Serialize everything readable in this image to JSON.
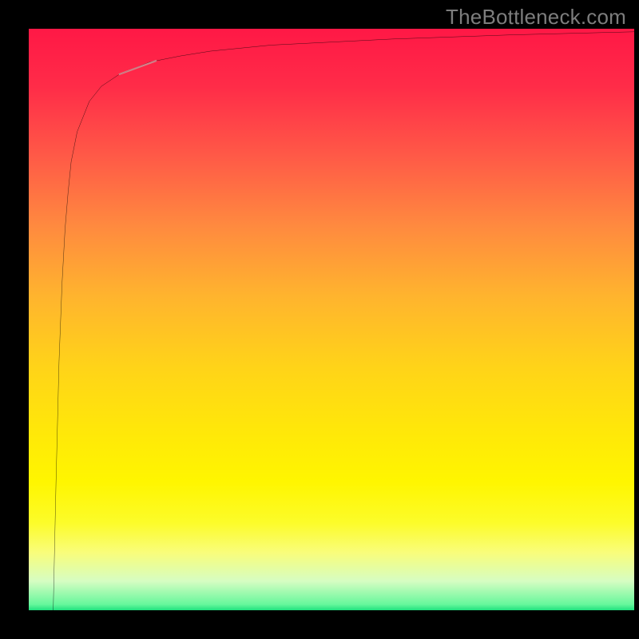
{
  "attribution": "TheBottleneck.com",
  "chart_data": {
    "type": "line",
    "title": "",
    "xlabel": "",
    "ylabel": "",
    "xlim": [
      0,
      100
    ],
    "ylim": [
      0,
      100
    ],
    "series": [
      {
        "name": "curve",
        "x": [
          4.0,
          4.5,
          5.0,
          5.5,
          6.0,
          6.5,
          7.0,
          8.0,
          10.0,
          12.0,
          15.0,
          20.0,
          25.0,
          30.0,
          40.0,
          60.0,
          80.0,
          100.0
        ],
        "values": [
          2.0,
          25.0,
          45.0,
          58.0,
          67.0,
          73.0,
          78.0,
          83.0,
          88.0,
          90.5,
          92.5,
          94.5,
          95.5,
          96.3,
          97.3,
          98.3,
          99.0,
          99.5
        ]
      }
    ],
    "marker": {
      "series": "curve",
      "x_start": 15.0,
      "x_end": 21.0
    },
    "background_gradient": {
      "orientation": "vertical",
      "stops": [
        {
          "pos": 0.0,
          "color": "#ff1846"
        },
        {
          "pos": 0.5,
          "color": "#ffd319"
        },
        {
          "pos": 0.9,
          "color": "#f9fd7a"
        },
        {
          "pos": 1.0,
          "color": "#1fe07e"
        }
      ]
    }
  }
}
